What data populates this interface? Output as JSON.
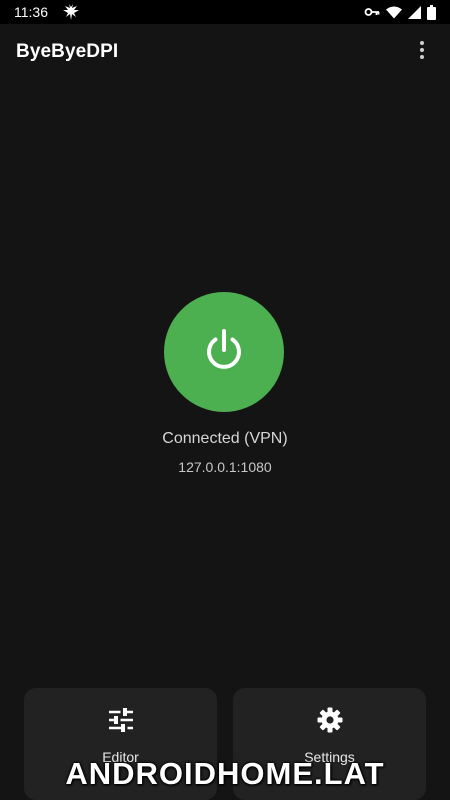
{
  "status_bar": {
    "time": "11:36",
    "icons": [
      "bird-logo-icon",
      "vpn-key-icon",
      "wifi-icon",
      "cellular-signal-icon",
      "battery-icon"
    ]
  },
  "app_bar": {
    "title": "ByeByeDPI",
    "menu_icon": "more-vert-icon"
  },
  "main": {
    "power_button_color": "#4caf50",
    "power_icon": "power-icon",
    "status": "Connected (VPN)",
    "address": "127.0.0.1:1080"
  },
  "bottom_buttons": [
    {
      "label": "Editor",
      "icon": "sliders-icon"
    },
    {
      "label": "Settings",
      "icon": "gear-icon"
    }
  ],
  "watermark": "ANDROIDHOME.LAT",
  "colors": {
    "background": "#141414",
    "status_bar": "#000000",
    "card": "#222222",
    "accent_green": "#4caf50"
  }
}
